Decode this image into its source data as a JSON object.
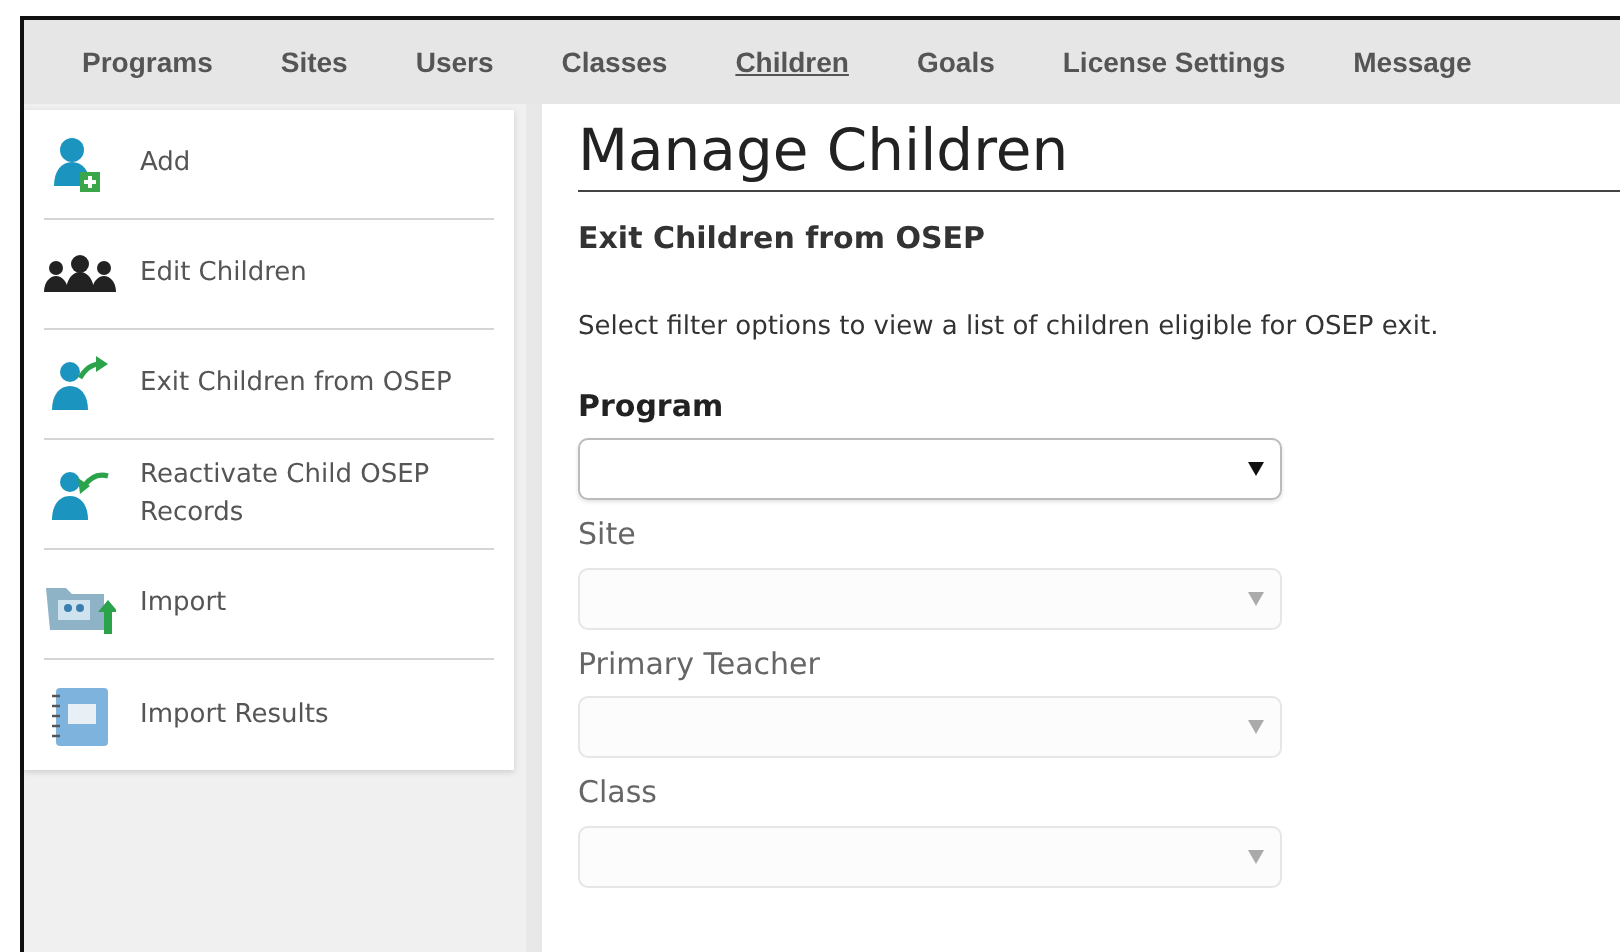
{
  "top_nav": [
    {
      "label": "Programs",
      "selected": false
    },
    {
      "label": "Sites",
      "selected": false
    },
    {
      "label": "Users",
      "selected": false
    },
    {
      "label": "Classes",
      "selected": false
    },
    {
      "label": "Children",
      "selected": true
    },
    {
      "label": "Goals",
      "selected": false
    },
    {
      "label": "License Settings",
      "selected": false
    },
    {
      "label": "Message",
      "selected": false
    }
  ],
  "sidebar": {
    "items": [
      {
        "label": "Add",
        "kind": "add"
      },
      {
        "label": "Edit Children",
        "kind": "group"
      },
      {
        "label": "Exit Children from OSEP",
        "kind": "exit"
      },
      {
        "label": "Reactivate Child OSEP Records",
        "kind": "reactivate"
      },
      {
        "label": "Import",
        "kind": "import"
      },
      {
        "label": "Import Results",
        "kind": "results"
      }
    ]
  },
  "page": {
    "title": "Manage Children",
    "subtitle": "Exit Children from OSEP",
    "description": "Select filter options to view a list of children eligible for OSEP exit.",
    "filters": [
      {
        "label": "Program",
        "disabled": false
      },
      {
        "label": "Site",
        "disabled": true
      },
      {
        "label": "Primary Teacher",
        "disabled": true
      },
      {
        "label": "Class",
        "disabled": true
      }
    ]
  }
}
